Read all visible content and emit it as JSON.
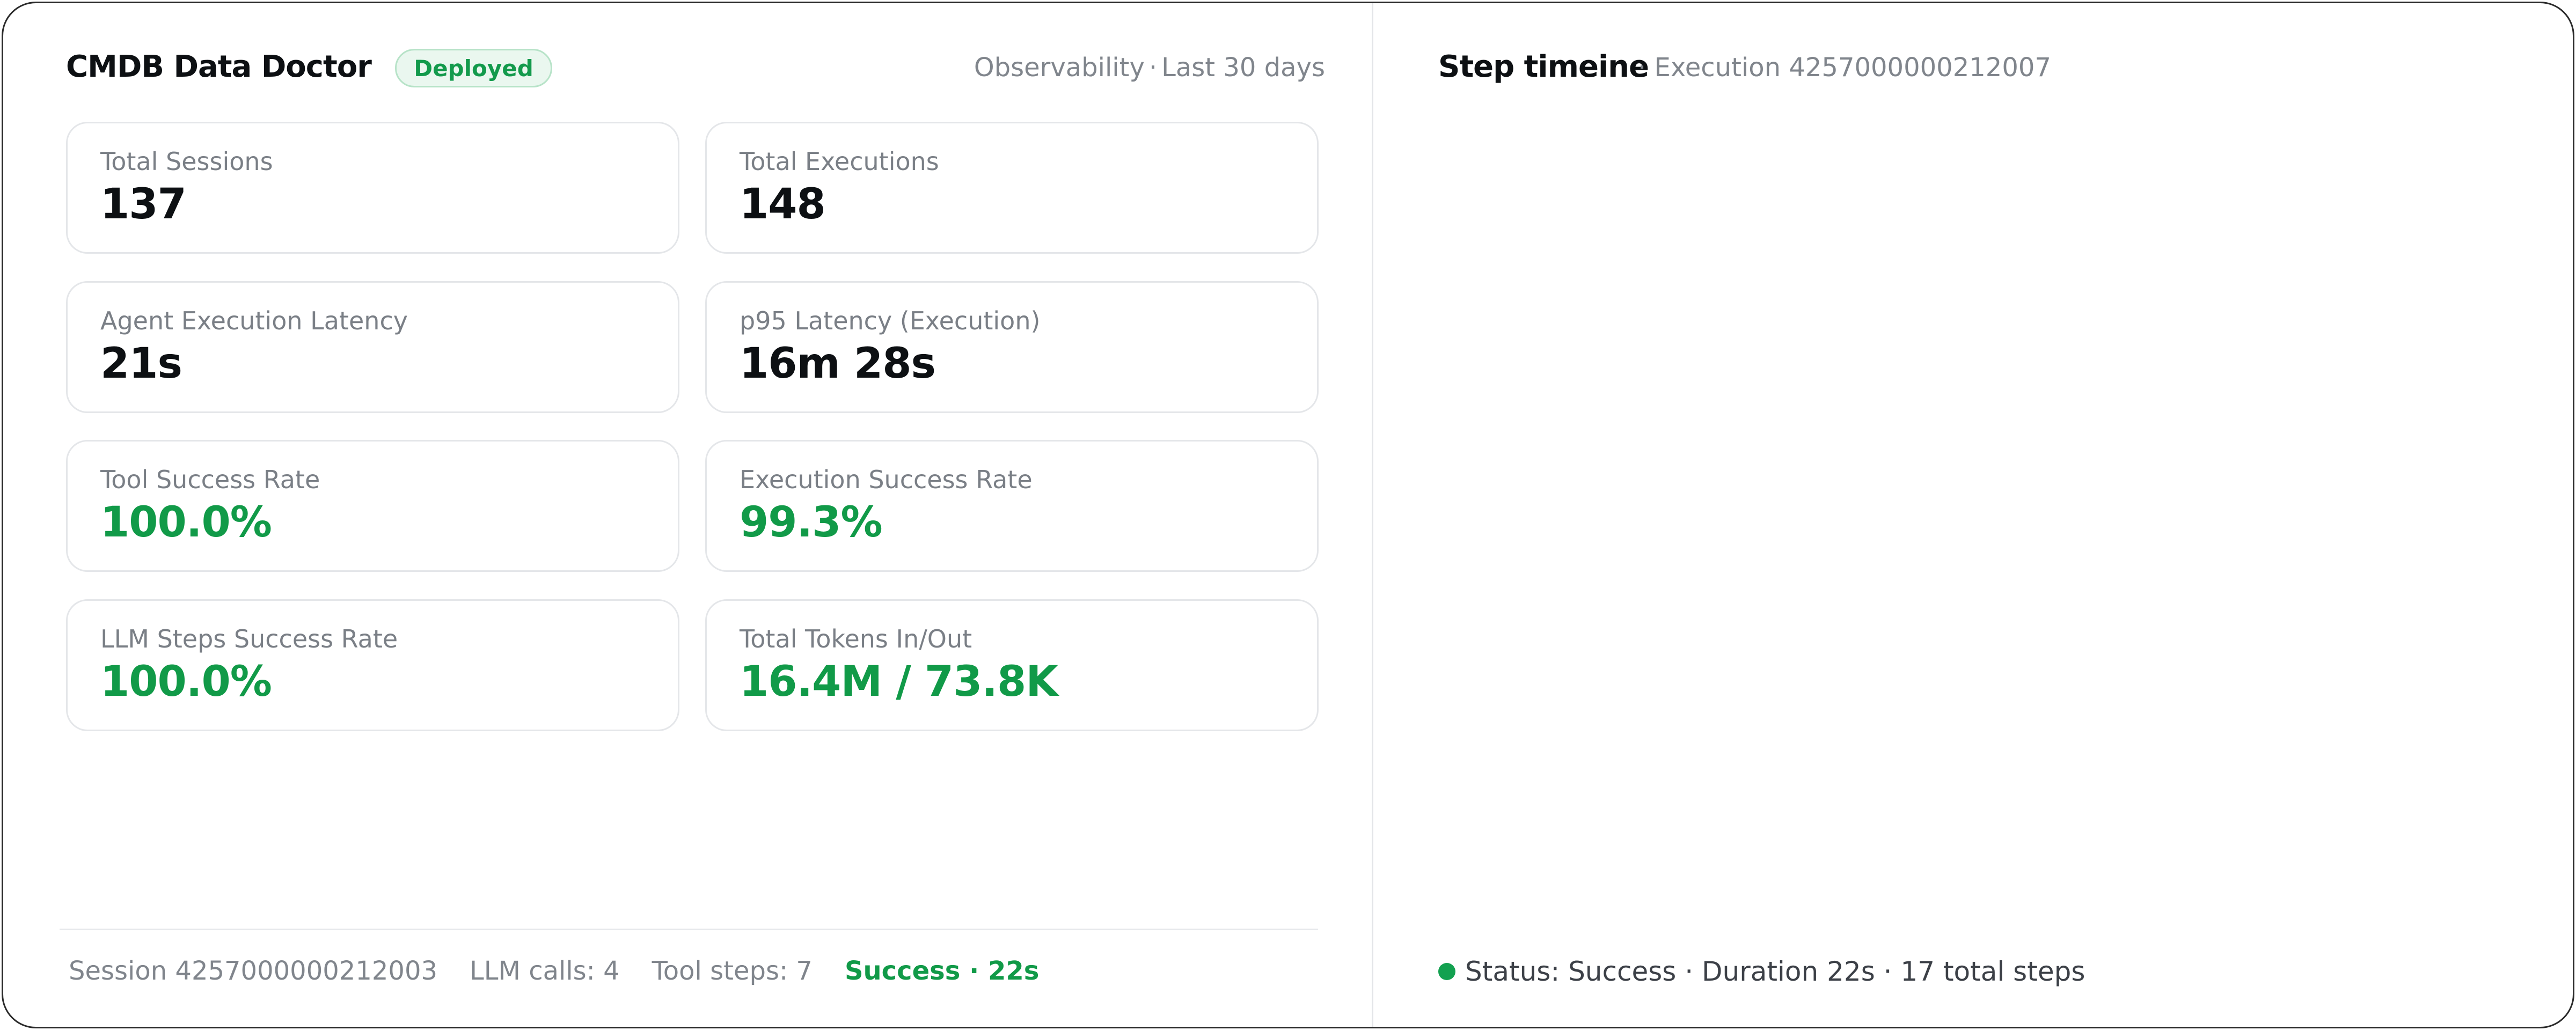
{
  "header": {
    "title": "CMDB Data Doctor",
    "badge": "Deployed",
    "scope_section": "Observability",
    "scope_separator": "·",
    "scope_range": "Last 30 days"
  },
  "metrics": [
    {
      "label": "Total Sessions",
      "value": "137"
    },
    {
      "label": "Total Executions",
      "value": "148"
    },
    {
      "label": "Agent Execution Latency",
      "value": "21s"
    },
    {
      "label": "p95 Latency (Execution)",
      "value": "16m 28s"
    },
    {
      "label": "Tool Success Rate",
      "value": "100.0%"
    },
    {
      "label": "Execution Success Rate",
      "value": "99.3%"
    },
    {
      "label": "LLM Steps Success Rate",
      "value": "100.0%"
    },
    {
      "label": "Total Tokens In/Out",
      "value": "16.4M / 73.8K"
    }
  ],
  "session_footer": {
    "session": "Session 4257000000212003",
    "llm_calls": "LLM calls: 4",
    "tool_steps": "Tool steps: 7",
    "result": "Success · 22s"
  },
  "timeline": {
    "title": "Step timeine",
    "subtitle": "· Execution 4257000000212007",
    "status_text": "Status: Success · Duration 22s · 17 total steps"
  },
  "colors": {
    "success_green": "#119a48",
    "badge_bg": "#eaf7ef",
    "badge_border": "#b7e3c8",
    "status_dot": "#13a150"
  }
}
